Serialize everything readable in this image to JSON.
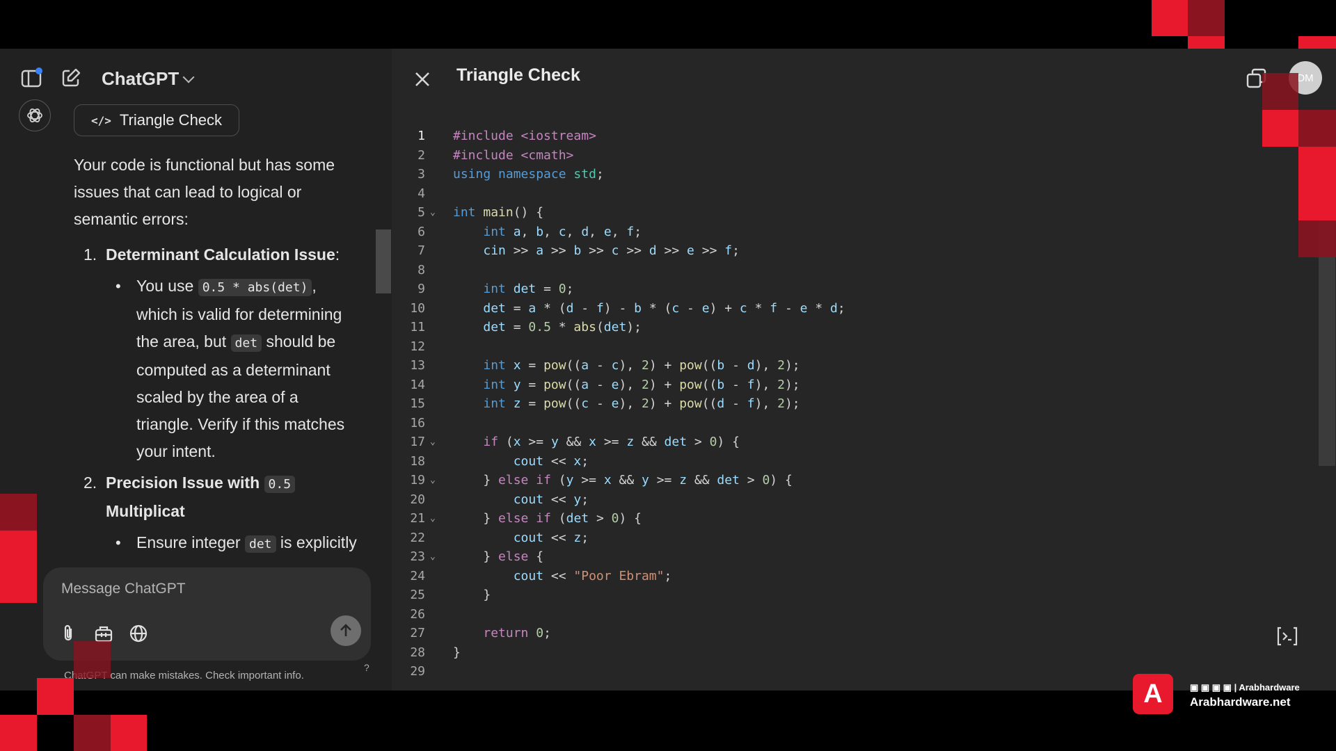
{
  "header": {
    "brand": "ChatGPT"
  },
  "conversation": {
    "canvas_chip_label": "Triangle Check",
    "intro": "Your code is functional but has some issues that can lead to logical or semantic errors:",
    "items": [
      {
        "number": "1.",
        "title": "Determinant Calculation Issue",
        "title_suffix": ":",
        "bullet_parts": [
          "You use ",
          "0.5 * abs(det)",
          ", which is valid for determining the area, but ",
          "det",
          " should be computed as a determinant scaled by the area of a triangle. Verify if this matches your intent."
        ]
      },
      {
        "number": "2.",
        "title": "Precision Issue with ",
        "title_code": "0.5",
        "title_rest": "Multiplicat",
        "bullet_parts": [
          "Ensure integer ",
          "det",
          " is explicitly"
        ]
      }
    ]
  },
  "composer": {
    "placeholder": "Message ChatGPT"
  },
  "disclaimer": "ChatGPT can make mistakes. Check important info.",
  "help": "?",
  "canvas": {
    "title": "Triangle Check",
    "avatar_initials": "DM",
    "code_lines": [
      "#include <iostream>",
      "#include <cmath>",
      "using namespace std;",
      "",
      "int main() {",
      "    int a, b, c, d, e, f;",
      "    cin >> a >> b >> c >> d >> e >> f;",
      "",
      "    int det = 0;",
      "    det = a * (d - f) - b * (c - e) + c * f - e * d;",
      "    det = 0.5 * abs(det);",
      "",
      "    int x = pow((a - c), 2) + pow((b - d), 2);",
      "    int y = pow((a - e), 2) + pow((b - f), 2);",
      "    int z = pow((c - e), 2) + pow((d - f), 2);",
      "",
      "    if (x >= y && x >= z && det > 0) {",
      "        cout << x;",
      "    } else if (y >= x && y >= z && det > 0) {",
      "        cout << y;",
      "    } else if (det > 0) {",
      "        cout << z;",
      "    } else {",
      "        cout << \"Poor Ebram\";",
      "    }",
      "",
      "    return 0;",
      "}",
      ""
    ],
    "fold_lines": [
      5,
      17,
      19,
      21,
      23
    ]
  },
  "watermark": {
    "social": "Arabhardware",
    "site": "Arabhardware.net",
    "brand_color": "#e8192c"
  },
  "colors": {
    "background": "#212121",
    "canvas": "#262626",
    "accent_red": "#e8192c"
  }
}
